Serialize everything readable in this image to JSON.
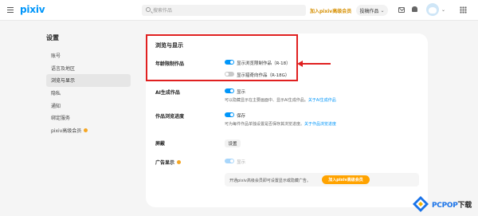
{
  "header": {
    "logo": "pixiv",
    "search_placeholder": "搜索作品",
    "premium_link": "加入pixiv高级会员",
    "post_button": "投稿作品"
  },
  "sidebar": {
    "title": "设置",
    "items": [
      {
        "label": "账号"
      },
      {
        "label": "语言及地区"
      },
      {
        "label": "浏览与显示"
      },
      {
        "label": "隐私"
      },
      {
        "label": "通知"
      },
      {
        "label": "绑定服务"
      },
      {
        "label": "pixiv高级会员"
      }
    ]
  },
  "main": {
    "title": "浏览与显示",
    "age_restriction": {
      "label": "年龄限制作品",
      "option_r18": "显示浏览限制作品（R-18）",
      "option_r18_on": true,
      "option_r18g": "显示猎奇向作品（R-18G）",
      "option_r18g_on": false
    },
    "ai": {
      "label": "AI生成作品",
      "toggle_text": "显示",
      "toggle_on": true,
      "desc": "可以隐藏显示在主要画面中、显示AI生成作品。",
      "desc_link": "关于AI生成作品"
    },
    "progress": {
      "label": "作品浏览进度",
      "toggle_text": "保存",
      "toggle_on": true,
      "desc": "可为每件作品单独设置是否保存其浏览进度。",
      "desc_link": "关于作品浏览进度"
    },
    "mute": {
      "label": "屏蔽",
      "button": "设置"
    },
    "ads": {
      "label": "广告显示",
      "toggle_text": "显示",
      "toggle_on": true,
      "premium_text": "开通pixiv高级会员即可设置显示或隐藏广告。",
      "premium_button": "加入pixiv高级会员"
    }
  },
  "watermark": {
    "brand": "PCPOP",
    "suffix": "下载"
  },
  "colors": {
    "accent": "#0096fa",
    "highlight": "#e02020",
    "premium": "#ffa300"
  }
}
